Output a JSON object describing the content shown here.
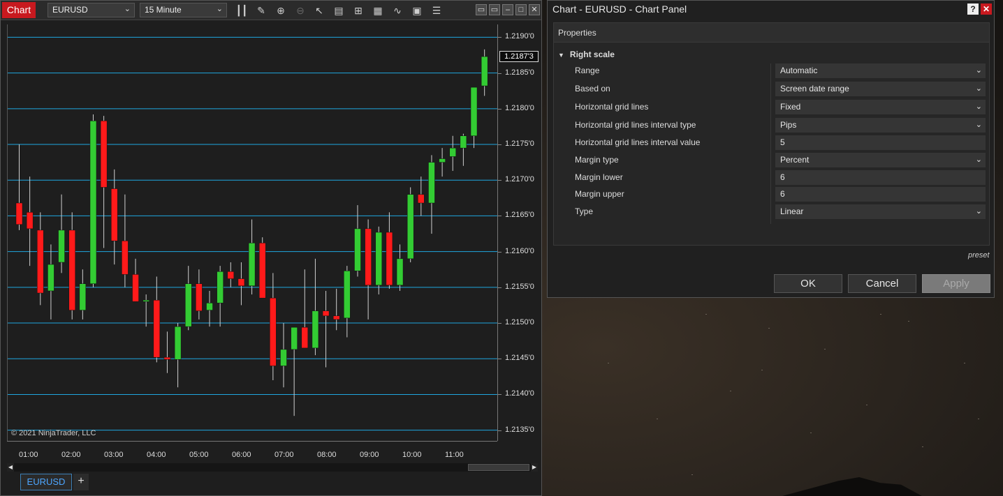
{
  "toolbar": {
    "tab_label": "Chart",
    "instrument": "EURUSD",
    "interval": "15 Minute",
    "icons": [
      "bar-type-icon",
      "drawing-tool-icon",
      "zoom-in-icon",
      "zoom-out-icon",
      "pointer-icon",
      "data-box-icon",
      "chart-trader-icon",
      "indicators-icon",
      "strategies-icon",
      "properties-icon",
      "list-icon"
    ]
  },
  "chart": {
    "copyright": "© 2021 NinjaTrader, LLC",
    "last_price_label": "1.2187'3",
    "symbol_tab": "EURUSD",
    "add_tab": "+"
  },
  "chart_data": {
    "type": "candlestick",
    "instrument": "EURUSD",
    "interval": "15 Minute",
    "y_tick_labels": [
      "1.2190'0",
      "1.2185'0",
      "1.2180'0",
      "1.2175'0",
      "1.2170'0",
      "1.2165'0",
      "1.2160'0",
      "1.2155'0",
      "1.2150'0",
      "1.2145'0",
      "1.2140'0",
      "1.2135'0"
    ],
    "y_ticks": [
      1.219,
      1.2185,
      1.218,
      1.2175,
      1.217,
      1.2165,
      1.216,
      1.2155,
      1.215,
      1.2145,
      1.214,
      1.2135
    ],
    "x_tick_labels": [
      "01:00",
      "02:00",
      "03:00",
      "04:00",
      "05:00",
      "06:00",
      "07:00",
      "08:00",
      "09:00",
      "10:00",
      "11:00"
    ],
    "ylim": [
      1.21335,
      1.21918
    ],
    "grid": true,
    "up_color": "#33cc33",
    "down_color": "#ff1a1a",
    "grid_color": "#1fa7e0",
    "candles": [
      {
        "o": 1.21668,
        "h": 1.2175,
        "l": 1.2163,
        "c": 1.21638
      },
      {
        "o": 1.21655,
        "h": 1.21705,
        "l": 1.2158,
        "c": 1.21632
      },
      {
        "o": 1.2163,
        "h": 1.21655,
        "l": 1.21525,
        "c": 1.21542
      },
      {
        "o": 1.21545,
        "h": 1.2161,
        "l": 1.21505,
        "c": 1.21582
      },
      {
        "o": 1.21585,
        "h": 1.2168,
        "l": 1.2157,
        "c": 1.2163
      },
      {
        "o": 1.2163,
        "h": 1.21655,
        "l": 1.21505,
        "c": 1.21518
      },
      {
        "o": 1.21518,
        "h": 1.21575,
        "l": 1.21505,
        "c": 1.21555
      },
      {
        "o": 1.21555,
        "h": 1.21792,
        "l": 1.2155,
        "c": 1.21783
      },
      {
        "o": 1.21783,
        "h": 1.2179,
        "l": 1.21605,
        "c": 1.2169
      },
      {
        "o": 1.21688,
        "h": 1.21715,
        "l": 1.21582,
        "c": 1.21615
      },
      {
        "o": 1.21615,
        "h": 1.2168,
        "l": 1.2155,
        "c": 1.21568
      },
      {
        "o": 1.21568,
        "h": 1.2159,
        "l": 1.21535,
        "c": 1.2153
      },
      {
        "o": 1.2153,
        "h": 1.2154,
        "l": 1.21495,
        "c": 1.21532
      },
      {
        "o": 1.21532,
        "h": 1.21565,
        "l": 1.21445,
        "c": 1.21452
      },
      {
        "o": 1.21452,
        "h": 1.21488,
        "l": 1.2143,
        "c": 1.21449
      },
      {
        "o": 1.21449,
        "h": 1.215,
        "l": 1.2141,
        "c": 1.21495
      },
      {
        "o": 1.21495,
        "h": 1.2158,
        "l": 1.2149,
        "c": 1.21555
      },
      {
        "o": 1.21555,
        "h": 1.21575,
        "l": 1.21505,
        "c": 1.21517
      },
      {
        "o": 1.21518,
        "h": 1.21545,
        "l": 1.21495,
        "c": 1.21528
      },
      {
        "o": 1.21528,
        "h": 1.2158,
        "l": 1.21495,
        "c": 1.21572
      },
      {
        "o": 1.21572,
        "h": 1.21585,
        "l": 1.2155,
        "c": 1.21562
      },
      {
        "o": 1.21562,
        "h": 1.21585,
        "l": 1.21525,
        "c": 1.21552
      },
      {
        "o": 1.21552,
        "h": 1.21645,
        "l": 1.2154,
        "c": 1.21612
      },
      {
        "o": 1.21612,
        "h": 1.2162,
        "l": 1.21535,
        "c": 1.21535
      },
      {
        "o": 1.21535,
        "h": 1.2157,
        "l": 1.2142,
        "c": 1.2144
      },
      {
        "o": 1.2144,
        "h": 1.215,
        "l": 1.2141,
        "c": 1.21463
      },
      {
        "o": 1.21463,
        "h": 1.2148,
        "l": 1.2137,
        "c": 1.21494
      },
      {
        "o": 1.21494,
        "h": 1.21575,
        "l": 1.21465,
        "c": 1.21465
      },
      {
        "o": 1.21465,
        "h": 1.2159,
        "l": 1.21455,
        "c": 1.21517
      },
      {
        "o": 1.21517,
        "h": 1.21545,
        "l": 1.21438,
        "c": 1.2151
      },
      {
        "o": 1.2151,
        "h": 1.21548,
        "l": 1.2149,
        "c": 1.21505
      },
      {
        "o": 1.21507,
        "h": 1.2158,
        "l": 1.2148,
        "c": 1.21573
      },
      {
        "o": 1.21573,
        "h": 1.21665,
        "l": 1.21565,
        "c": 1.21632
      },
      {
        "o": 1.21632,
        "h": 1.21645,
        "l": 1.21505,
        "c": 1.21553
      },
      {
        "o": 1.21553,
        "h": 1.21635,
        "l": 1.2154,
        "c": 1.21627
      },
      {
        "o": 1.21627,
        "h": 1.21655,
        "l": 1.21548,
        "c": 1.21553
      },
      {
        "o": 1.21553,
        "h": 1.2161,
        "l": 1.21545,
        "c": 1.2159
      },
      {
        "o": 1.2159,
        "h": 1.2169,
        "l": 1.21585,
        "c": 1.2168
      },
      {
        "o": 1.2168,
        "h": 1.21705,
        "l": 1.2165,
        "c": 1.21668
      },
      {
        "o": 1.21668,
        "h": 1.21735,
        "l": 1.21625,
        "c": 1.21725
      },
      {
        "o": 1.21725,
        "h": 1.21745,
        "l": 1.21705,
        "c": 1.2173
      },
      {
        "o": 1.21733,
        "h": 1.21762,
        "l": 1.21713,
        "c": 1.21745
      },
      {
        "o": 1.21745,
        "h": 1.21765,
        "l": 1.2172,
        "c": 1.21762
      },
      {
        "o": 1.21762,
        "h": 1.2179,
        "l": 1.21745,
        "c": 1.2183
      },
      {
        "o": 1.21832,
        "h": 1.21883,
        "l": 1.21818,
        "c": 1.21873
      }
    ]
  },
  "dialog": {
    "title": "Chart - EURUSD - Chart Panel",
    "help": "?",
    "close": "✕",
    "properties_header": "Properties",
    "section": "Right scale",
    "rows": [
      {
        "label": "Range",
        "value": "Automatic",
        "dropdown": true
      },
      {
        "label": "Based on",
        "value": "Screen date range",
        "dropdown": true
      },
      {
        "label": "Horizontal grid lines",
        "value": "Fixed",
        "dropdown": true
      },
      {
        "label": "Horizontal grid lines interval type",
        "value": "Pips",
        "dropdown": true
      },
      {
        "label": "Horizontal grid lines interval value",
        "value": "5",
        "dropdown": false
      },
      {
        "label": "Margin type",
        "value": "Percent",
        "dropdown": true
      },
      {
        "label": "Margin lower",
        "value": "6",
        "dropdown": false
      },
      {
        "label": "Margin upper",
        "value": "6",
        "dropdown": false
      },
      {
        "label": "Type",
        "value": "Linear",
        "dropdown": true
      }
    ],
    "preset": "preset",
    "ok": "OK",
    "cancel": "Cancel",
    "apply": "Apply"
  }
}
